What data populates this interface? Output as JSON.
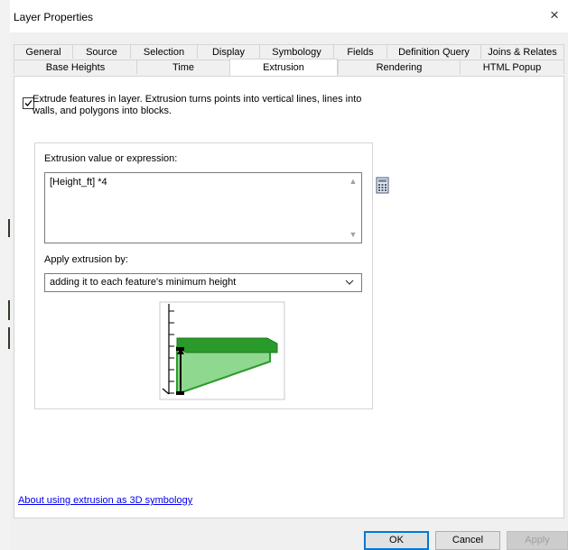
{
  "dialog": {
    "title": "Layer Properties",
    "close_symbol": "×"
  },
  "tabs_row1": [
    "General",
    "Source",
    "Selection",
    "Display",
    "Symbology",
    "Fields",
    "Definition Query",
    "Joins & Relates"
  ],
  "tabs_row2": [
    "Base Heights",
    "Time",
    "Extrusion",
    "Rendering",
    "HTML Popup"
  ],
  "active_tab": "Extrusion",
  "extrusion": {
    "checkbox_label": "Extrude features in layer.  Extrusion turns points into vertical lines, lines into walls, and polygons into blocks.",
    "checkbox_checked": true,
    "expression_label": "Extrusion value or expression:",
    "expression_value": "[Height_ft] *4",
    "apply_label": "Apply extrusion by:",
    "apply_value": "adding it to each feature's minimum height",
    "help_link": "About using extrusion as 3D symbology"
  },
  "buttons": {
    "ok": "OK",
    "cancel": "Cancel",
    "apply": "Apply"
  },
  "colors": {
    "accent": "#0078d7",
    "link": "#0000ee",
    "block_top": "#2a9a2a",
    "block_side": "#8fd88f"
  }
}
